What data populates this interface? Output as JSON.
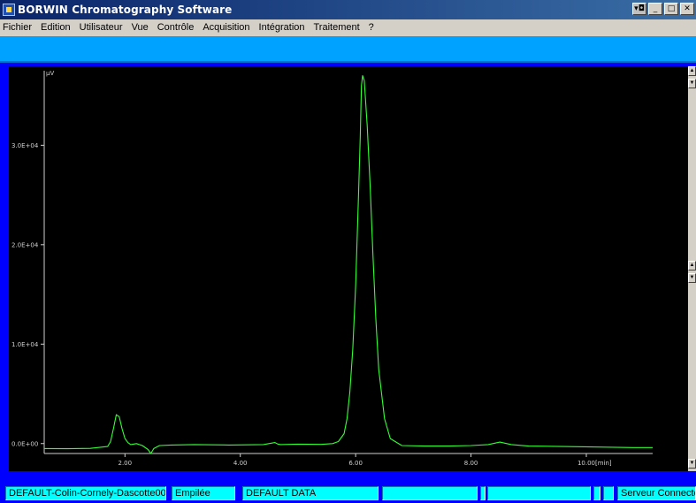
{
  "window": {
    "title": "BORWIN Chromatography Software",
    "controls": {
      "system": "▾◘",
      "minimize": "_",
      "maximize": "□",
      "close": "✕"
    }
  },
  "menubar": {
    "items": [
      "Fichier",
      "Edition",
      "Utilisateur",
      "Vue",
      "Contrôle",
      "Acquisition",
      "Intégration",
      "Traitement",
      "?"
    ]
  },
  "statusbar": {
    "panels": [
      "DEFAULT-Colin-Cornely-Dascotte00",
      "Empilée",
      "DEFAULT  DATA",
      "",
      "",
      "",
      "",
      "",
      "Serveur Connecté"
    ]
  },
  "colors": {
    "trace": "#33ff33",
    "axis": "#d0d0d0",
    "background": "#000000",
    "workspace": "#0000ff",
    "toolbar": "#00a2ff",
    "status_panel": "#00ffff"
  },
  "icons": {
    "app": "chromatograph-app-icon",
    "scroll_up": "arrow-up-icon",
    "scroll_down": "arrow-down-icon"
  },
  "chart_data": {
    "type": "line",
    "ylabel": "µV",
    "xunit": "[min]",
    "xlim": [
      0.6,
      11.15
    ],
    "ylim": [
      -1000,
      37500
    ],
    "xticks": [
      2.0,
      4.0,
      6.0,
      8.0,
      10.0
    ],
    "xtick_labels": [
      "2.00",
      "4.00",
      "6.00",
      "8.00",
      "10.00"
    ],
    "yticks": [
      0,
      10000,
      20000,
      30000
    ],
    "ytick_labels": [
      "0.0E+00",
      "1.0E+04",
      "2.0E+04",
      "3.0E+04"
    ],
    "grid": false,
    "series": [
      {
        "x": [
          0.6,
          1.0,
          1.4,
          1.7,
          1.75,
          1.8,
          1.85,
          1.9,
          1.95,
          2.0,
          2.05,
          2.1,
          2.2,
          2.3,
          2.4,
          2.45,
          2.5,
          2.6,
          2.8,
          3.2,
          3.8,
          4.4,
          4.6,
          4.65,
          4.7,
          5.0,
          5.4,
          5.6,
          5.7,
          5.8,
          5.85,
          5.9,
          5.95,
          6.0,
          6.05,
          6.08,
          6.1,
          6.12,
          6.15,
          6.2,
          6.25,
          6.3,
          6.35,
          6.4,
          6.5,
          6.6,
          6.8,
          7.2,
          7.6,
          8.0,
          8.3,
          8.5,
          8.7,
          9.0,
          9.6,
          10.2,
          10.8,
          11.15
        ],
        "y": [
          -500,
          -520,
          -480,
          -300,
          200,
          1500,
          2900,
          2700,
          1500,
          500,
          100,
          -100,
          0,
          -200,
          -600,
          -1000,
          -500,
          -200,
          -150,
          -100,
          -150,
          -100,
          100,
          -50,
          -100,
          -60,
          -80,
          0,
          200,
          1000,
          2500,
          5200,
          9500,
          16000,
          25000,
          31000,
          36000,
          37000,
          36500,
          32000,
          26000,
          19000,
          12500,
          7500,
          2500,
          500,
          -200,
          -250,
          -250,
          -200,
          -100,
          150,
          -100,
          -250,
          -300,
          -350,
          -400,
          -400
        ]
      }
    ]
  }
}
